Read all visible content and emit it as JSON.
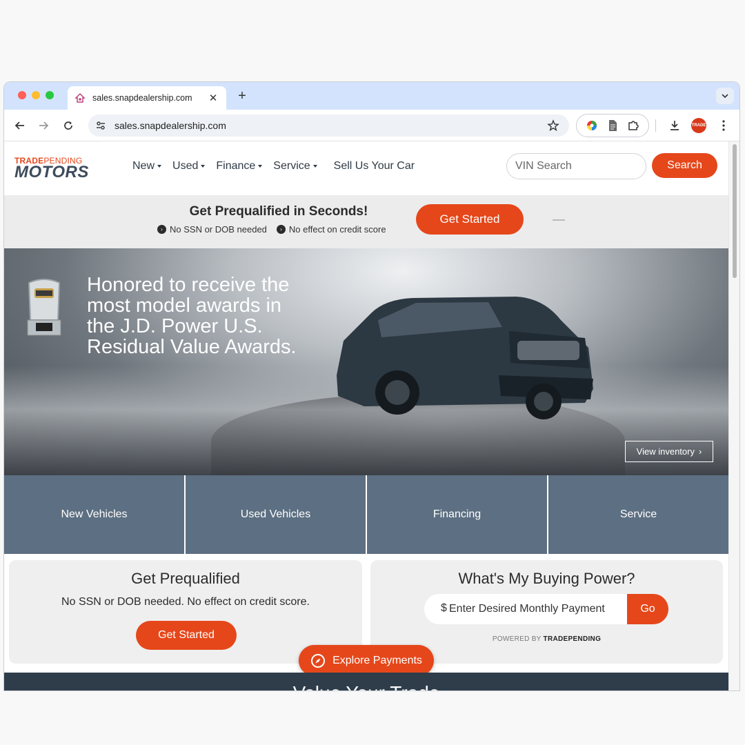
{
  "browser": {
    "tab_title": "sales.snapdealership.com",
    "address": "sales.snapdealership.com",
    "dot_colors": [
      "#fe5f57",
      "#febc2e",
      "#28c840"
    ]
  },
  "header": {
    "logo_top_a": "TRADE",
    "logo_top_b": "PENDING",
    "logo_bottom": "MOTORS",
    "nav": [
      {
        "label": "New"
      },
      {
        "label": "Used"
      },
      {
        "label": "Finance"
      },
      {
        "label": "Service"
      }
    ],
    "sell_label": "Sell Us Your Car",
    "vin_placeholder": "VIN Search",
    "search_label": "Search"
  },
  "prequal_banner": {
    "title": "Get Prequalified in Seconds!",
    "point1": "No SSN or DOB needed",
    "point2": "No effect on credit score",
    "button": "Get Started"
  },
  "hero": {
    "headline": "Honored to receive the most model awards in the J.D. Power U.S. Residual Value Awards.",
    "view_inventory": "View inventory"
  },
  "tiles": [
    "New Vehicles",
    "Used Vehicles",
    "Financing",
    "Service"
  ],
  "prequal_card": {
    "title": "Get Prequalified",
    "subtitle": "No SSN or DOB needed. No effect on credit score.",
    "button": "Get Started"
  },
  "buying_power": {
    "title": "What's My Buying Power?",
    "dollar": "$",
    "placeholder": "Enter Desired Monthly Payment",
    "go": "Go",
    "powered_by": "POWERED BY",
    "powered_brand": "TRADEPENDING"
  },
  "explore_payments": "Explore Payments",
  "trade_section_title": "Value Your Trade",
  "colors": {
    "accent": "#e5471a",
    "tile_bg": "#5d6f82",
    "dark_strip": "#2f3d4b",
    "tab_strip": "#d3e3fd"
  }
}
